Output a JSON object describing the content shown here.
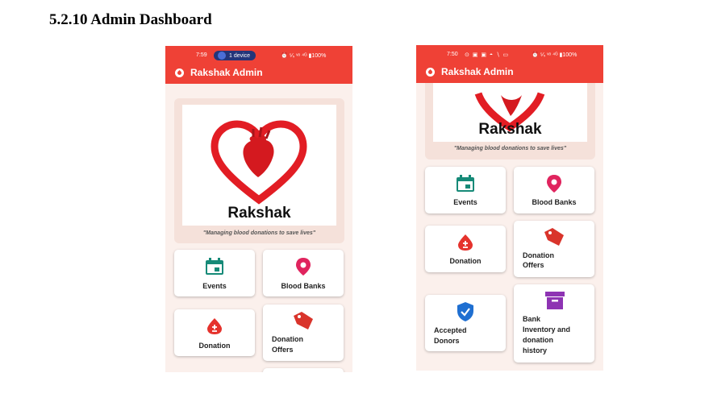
{
  "heading": "5.2.10 Admin Dashboard",
  "colors": {
    "appbar": "#ef4136",
    "heart": "#e21d24",
    "events": "#168a78",
    "bloodbanks": "#e0245e",
    "donation": "#e5322c",
    "offers": "#d9342b",
    "accepted": "#1f6fd1",
    "inventory": "#8e33b3"
  },
  "phone1": {
    "status": {
      "time": "7:59",
      "pill": "1 device",
      "right": "⏰ ⁵⁄ₛ ᵛᵒ ⁴ᴳ ▮100%"
    },
    "app_title": "Rakshak Admin",
    "brand": "Rakshak",
    "tagline": "\"Managing blood donations to save lives\"",
    "tiles": {
      "events": "Events",
      "blood_banks": "Blood Banks",
      "donation": "Donation",
      "donation_offers_1": "Donation",
      "donation_offers_2": "Offers"
    }
  },
  "phone2": {
    "status": {
      "time": "7:50",
      "icons": "⊙ ▣ ▣ ◓ ∖ ▭",
      "right": "⏰ ⁵⁄ₛ ᵛᵒ ⁴ᴳ ▮100%"
    },
    "app_title": "Rakshak Admin",
    "brand": "Rakshak",
    "tagline": "\"Managing blood donations to save lives\"",
    "tiles": {
      "events": "Events",
      "blood_banks": "Blood Banks",
      "donation": "Donation",
      "donation_offers_1": "Donation",
      "donation_offers_2": "Offers",
      "accepted_1": "Accepted",
      "accepted_2": "Donors",
      "inventory_1": "Bank",
      "inventory_2": "Inventory and",
      "inventory_3": "donation",
      "inventory_4": "history"
    }
  }
}
